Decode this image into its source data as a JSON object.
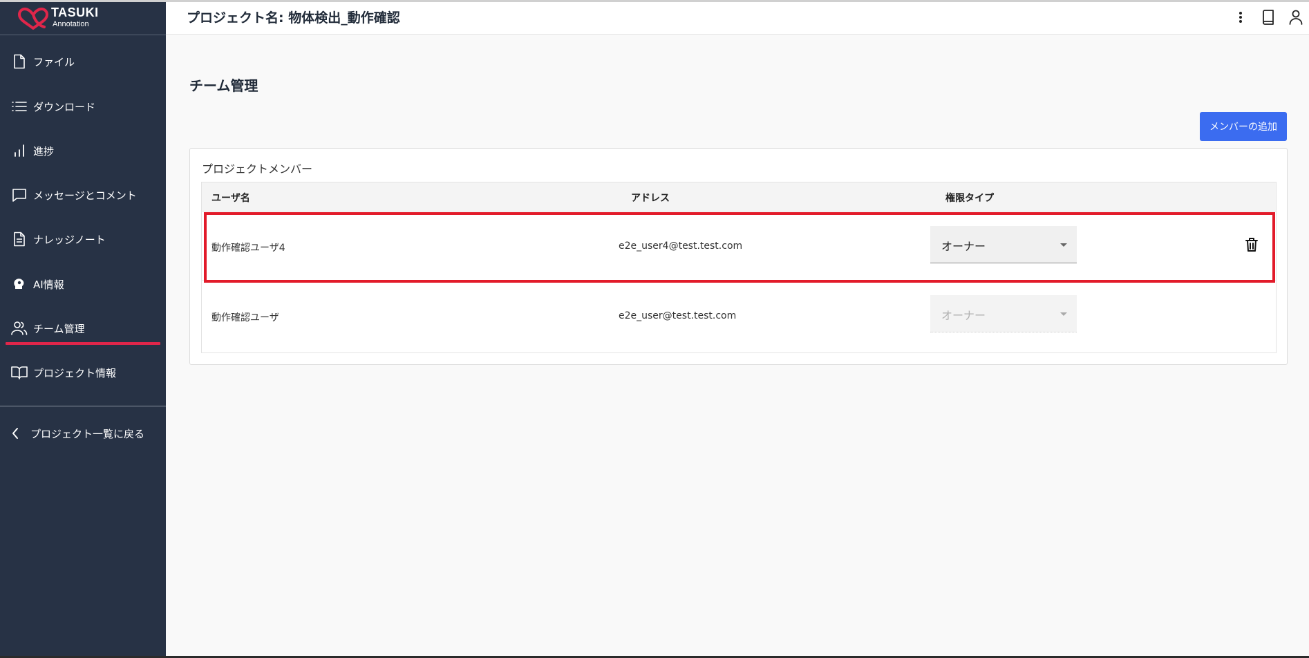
{
  "colors": {
    "sidebar_bg": "#273245",
    "accent_red": "#e0264a",
    "primary_button": "#3b6cf0",
    "highlight_box": "#e21b2a"
  },
  "logo": {
    "title": "TASUKI",
    "subtitle": "Annotation"
  },
  "sidebar": {
    "items": [
      {
        "label": "ファイル",
        "icon": "file-icon"
      },
      {
        "label": "ダウンロード",
        "icon": "list-icon"
      },
      {
        "label": "進捗",
        "icon": "bar-chart-icon"
      },
      {
        "label": "メッセージとコメント",
        "icon": "message-icon"
      },
      {
        "label": "ナレッジノート",
        "icon": "document-icon"
      },
      {
        "label": "AI情報",
        "icon": "brain-icon"
      },
      {
        "label": "チーム管理",
        "icon": "users-icon",
        "active": true
      },
      {
        "label": "プロジェクト情報",
        "icon": "book-open-icon"
      }
    ],
    "back": {
      "label": "プロジェクト一覧に戻る",
      "icon": "chevron-left-icon"
    }
  },
  "header": {
    "title": "プロジェクト名: 物体検出_動作確認",
    "icons": [
      "more-vertical-icon",
      "book-icon",
      "user-icon"
    ]
  },
  "main": {
    "page_title": "チーム管理",
    "add_member_button": "メンバーの追加",
    "card": {
      "title": "プロジェクトメンバー",
      "columns": [
        "ユーザ名",
        "アドレス",
        "権限タイプ"
      ],
      "rows": [
        {
          "user": "動作確認ユーザ4",
          "email": "e2e_user4@test.test.com",
          "role": "オーナー",
          "role_editable": true,
          "deletable": true,
          "highlighted": true
        },
        {
          "user": "動作確認ユーザ",
          "email": "e2e_user@test.test.com",
          "role": "オーナー",
          "role_editable": false,
          "deletable": false,
          "highlighted": false
        }
      ]
    }
  }
}
